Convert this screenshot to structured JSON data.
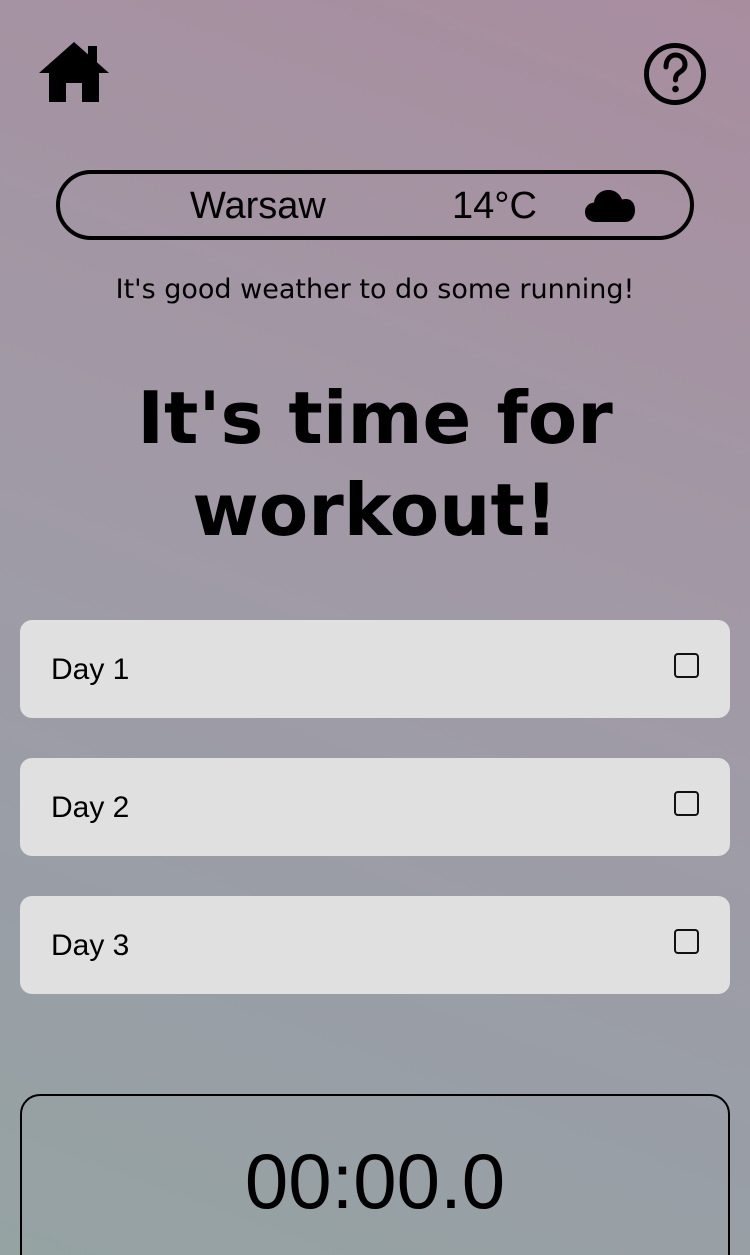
{
  "nav": {
    "home_icon": "home-icon",
    "help_icon": "help-circle-icon"
  },
  "weather": {
    "city": "Warsaw",
    "temperature": "14°C",
    "condition_icon": "cloud-icon",
    "tip": "It's good weather to do some running!"
  },
  "headline": "It's time for workout!",
  "days": [
    {
      "label": "Day 1",
      "checked": false
    },
    {
      "label": "Day 2",
      "checked": false
    },
    {
      "label": "Day 3",
      "checked": false
    }
  ],
  "timer": {
    "display": "00:00.0"
  }
}
